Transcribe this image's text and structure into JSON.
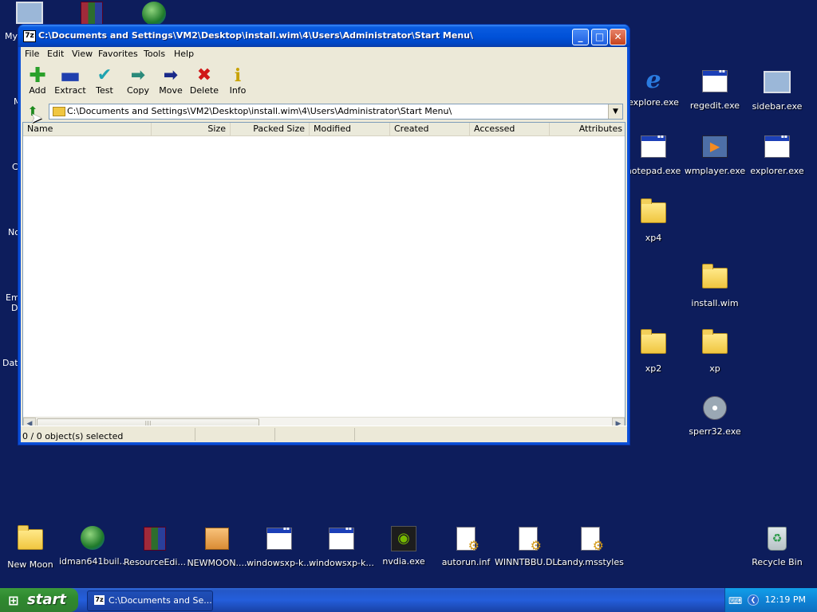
{
  "window": {
    "title": "C:\\Documents and Settings\\VM2\\Desktop\\install.wim\\4\\Users\\Administrator\\Start Menu\\",
    "app_icon": "7z"
  },
  "menu": [
    "File",
    "Edit",
    "View",
    "Favorites",
    "Tools",
    "Help"
  ],
  "toolbar": [
    {
      "label": "Add",
      "icon": "plus-icon",
      "color": "#2aa02a"
    },
    {
      "label": "Extract",
      "icon": "minus-icon",
      "color": "#1f3fae"
    },
    {
      "label": "Test",
      "icon": "check-icon",
      "color": "#1fa3b0"
    },
    {
      "label": "Copy",
      "icon": "copy-arrow-icon",
      "color": "#2a8a7a"
    },
    {
      "label": "Move",
      "icon": "move-arrow-icon",
      "color": "#1a2a8a"
    },
    {
      "label": "Delete",
      "icon": "x-icon",
      "color": "#d01818"
    },
    {
      "label": "Info",
      "icon": "info-icon",
      "color": "#c8a200"
    }
  ],
  "address": "C:\\Documents and Settings\\VM2\\Desktop\\install.wim\\4\\Users\\Administrator\\Start Menu\\",
  "columns": [
    "Name",
    "Size",
    "Packed Size",
    "Modified",
    "Created",
    "Accessed",
    "Attributes"
  ],
  "status": "0 / 0 object(s) selected",
  "desktop_left_labels": [
    "My",
    "M",
    "C",
    "No",
    "Em",
    "D",
    "Dat"
  ],
  "desktop_icons_right": [
    {
      "label": "explore.exe",
      "type": "ie"
    },
    {
      "label": "regedit.exe",
      "type": "win"
    },
    {
      "label": "sidebar.exe",
      "type": "pc"
    },
    {
      "label": "notepad.exe",
      "type": "win"
    },
    {
      "label": "wmplayer.exe",
      "type": "media"
    },
    {
      "label": "explorer.exe",
      "type": "win"
    },
    {
      "label": "xp4",
      "type": "folder"
    },
    {
      "label": "install.wim",
      "type": "folder"
    },
    {
      "label": "xp2",
      "type": "folder"
    },
    {
      "label": "xp",
      "type": "folder"
    },
    {
      "label": "sperr32.exe",
      "type": "disc"
    }
  ],
  "desktop_icons_bottom": [
    {
      "label": "New Moon",
      "type": "folder"
    },
    {
      "label": "idman641buil...",
      "type": "globe"
    },
    {
      "label": "ResourceEdi...",
      "type": "rar"
    },
    {
      "label": "NEWMOON....",
      "type": "box"
    },
    {
      "label": "windowsxp-k...",
      "type": "win"
    },
    {
      "label": "windowsxp-k...",
      "type": "win"
    },
    {
      "label": "nvdia.exe",
      "type": "nv"
    },
    {
      "label": "autorun.inf",
      "type": "doc"
    },
    {
      "label": "WINNTBBU.DLL",
      "type": "doc"
    },
    {
      "label": "candy.msstyles",
      "type": "doc"
    },
    {
      "label": "Recycle Bin",
      "type": "bin"
    }
  ],
  "taskbar": {
    "start_label": "start",
    "task_label": "C:\\Documents and Se...",
    "clock": "12:19 PM"
  }
}
